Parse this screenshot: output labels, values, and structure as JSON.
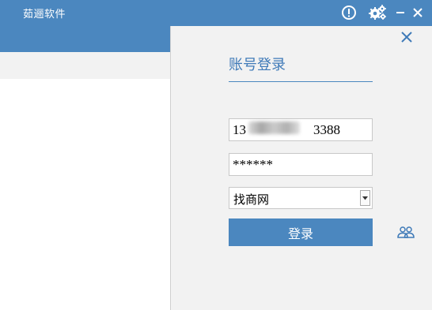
{
  "window": {
    "title": "茹逦软件",
    "controls": {
      "info_icon": "info-circle-icon",
      "settings_icon": "gear-icon",
      "minimize_icon": "minimize-icon",
      "close_icon": "close-icon"
    }
  },
  "login_panel": {
    "title": "账号登录",
    "account_value": "13     3388",
    "password_value": "******",
    "platform_select": {
      "selected": "找商网"
    },
    "login_button_label": "登录",
    "users_icon": "users-icon",
    "close_icon": "close-x-icon"
  },
  "colors": {
    "brand_blue": "#4b87bf",
    "panel_bg": "#f2f2f2"
  }
}
